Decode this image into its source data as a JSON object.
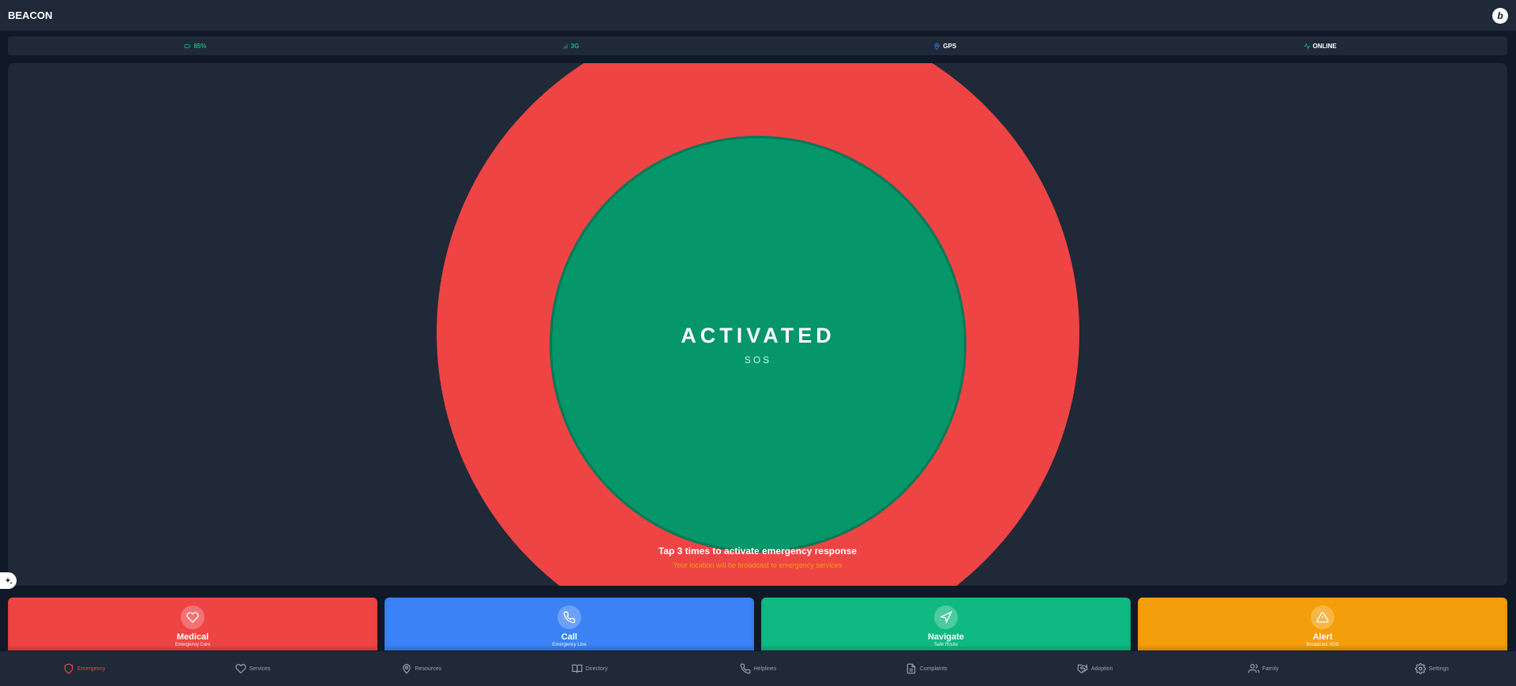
{
  "app": {
    "brand": "BEACON",
    "avatar_letter": "b"
  },
  "status": {
    "battery": {
      "label": "85%",
      "icon": "battery-icon",
      "color": "#10b981"
    },
    "network": {
      "label": "3G",
      "icon": "signal-icon",
      "color": "#10b981"
    },
    "gps": {
      "label": "GPS",
      "icon": "map-pin-icon",
      "color": "#3b82f6"
    },
    "connection": {
      "label": "ONLINE",
      "icon": "activity-icon",
      "color": "#10b981"
    }
  },
  "sos": {
    "title": "ACTIVATED",
    "subtitle": "SOS",
    "hint": "Tap 3 times to activate emergency response",
    "hint_sub": "Your location will be broadcast to emergency services",
    "ring_color": "#ef4444",
    "core_color": "#059669"
  },
  "actions": [
    {
      "label": "Medical",
      "sub": "Emergency Care",
      "icon": "heart-icon",
      "color": "#ef4444"
    },
    {
      "label": "Call",
      "sub": "Emergency Line",
      "icon": "phone-icon",
      "color": "#3b82f6"
    },
    {
      "label": "Navigate",
      "sub": "Safe Route",
      "icon": "navigation-icon",
      "color": "#10b981"
    },
    {
      "label": "Alert",
      "sub": "Broadcast SOS",
      "icon": "alert-triangle-icon",
      "color": "#f59e0b"
    }
  ],
  "nav": [
    {
      "label": "Emergency",
      "icon": "shield-icon",
      "active": true
    },
    {
      "label": "Services",
      "icon": "heart-icon"
    },
    {
      "label": "Resources",
      "icon": "map-pin-icon"
    },
    {
      "label": "Directory",
      "icon": "book-icon"
    },
    {
      "label": "Helplines",
      "icon": "phone-icon"
    },
    {
      "label": "Complaints",
      "icon": "file-text-icon"
    },
    {
      "label": "Adoption",
      "icon": "handshake-icon"
    },
    {
      "label": "Family",
      "icon": "users-icon"
    },
    {
      "label": "Settings",
      "icon": "gear-icon"
    }
  ]
}
